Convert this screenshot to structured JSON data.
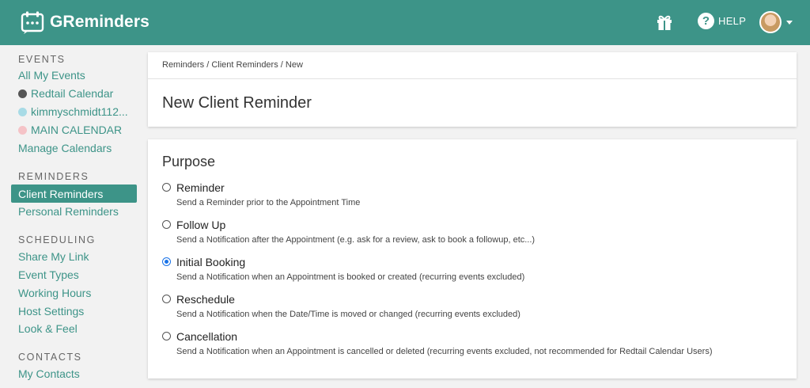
{
  "header": {
    "brand": "GReminders",
    "help_label": "HELP"
  },
  "sidebar": {
    "events_title": "EVENTS",
    "events": [
      {
        "label": "All My Events"
      },
      {
        "label": "Redtail Calendar",
        "color": "#555555"
      },
      {
        "label": "kimmyschmidt112...",
        "color": "#a8dbe6"
      },
      {
        "label": "MAIN CALENDAR",
        "color": "#f5c3c7"
      },
      {
        "label": "Manage Calendars"
      }
    ],
    "reminders_title": "REMINDERS",
    "reminders": [
      {
        "label": "Client Reminders",
        "active": true
      },
      {
        "label": "Personal Reminders"
      }
    ],
    "scheduling_title": "SCHEDULING",
    "scheduling": [
      {
        "label": "Share My Link"
      },
      {
        "label": "Event Types"
      },
      {
        "label": "Working Hours"
      },
      {
        "label": "Host Settings"
      },
      {
        "label": "Look & Feel"
      }
    ],
    "contacts_title": "CONTACTS",
    "contacts": [
      {
        "label": "My Contacts"
      }
    ]
  },
  "main": {
    "breadcrumb": "Reminders / Client Reminders / New",
    "title": "New Client Reminder",
    "purpose_title": "Purpose",
    "options": [
      {
        "label": "Reminder",
        "desc": "Send a Reminder prior to the Appointment Time",
        "selected": false
      },
      {
        "label": "Follow Up",
        "desc": "Send a Notification after the Appointment (e.g. ask for a review, ask to book a followup, etc...)",
        "selected": false
      },
      {
        "label": "Initial Booking",
        "desc": "Send a Notification when an Appointment is booked or created (recurring events excluded)",
        "selected": true
      },
      {
        "label": "Reschedule",
        "desc": "Send a Notification when the Date/Time is moved or changed (recurring events excluded)",
        "selected": false
      },
      {
        "label": "Cancellation",
        "desc": "Send a Notification when an Appointment is cancelled or deleted (recurring events excluded, not recommended for Redtail Calendar Users)",
        "selected": false
      }
    ]
  },
  "colors": {
    "brand": "#3d9488",
    "radio_selected": "#1a73e8"
  },
  "icons": [
    "calendar-icon",
    "gift-icon",
    "help-icon",
    "avatar",
    "chevron-down-icon"
  ]
}
